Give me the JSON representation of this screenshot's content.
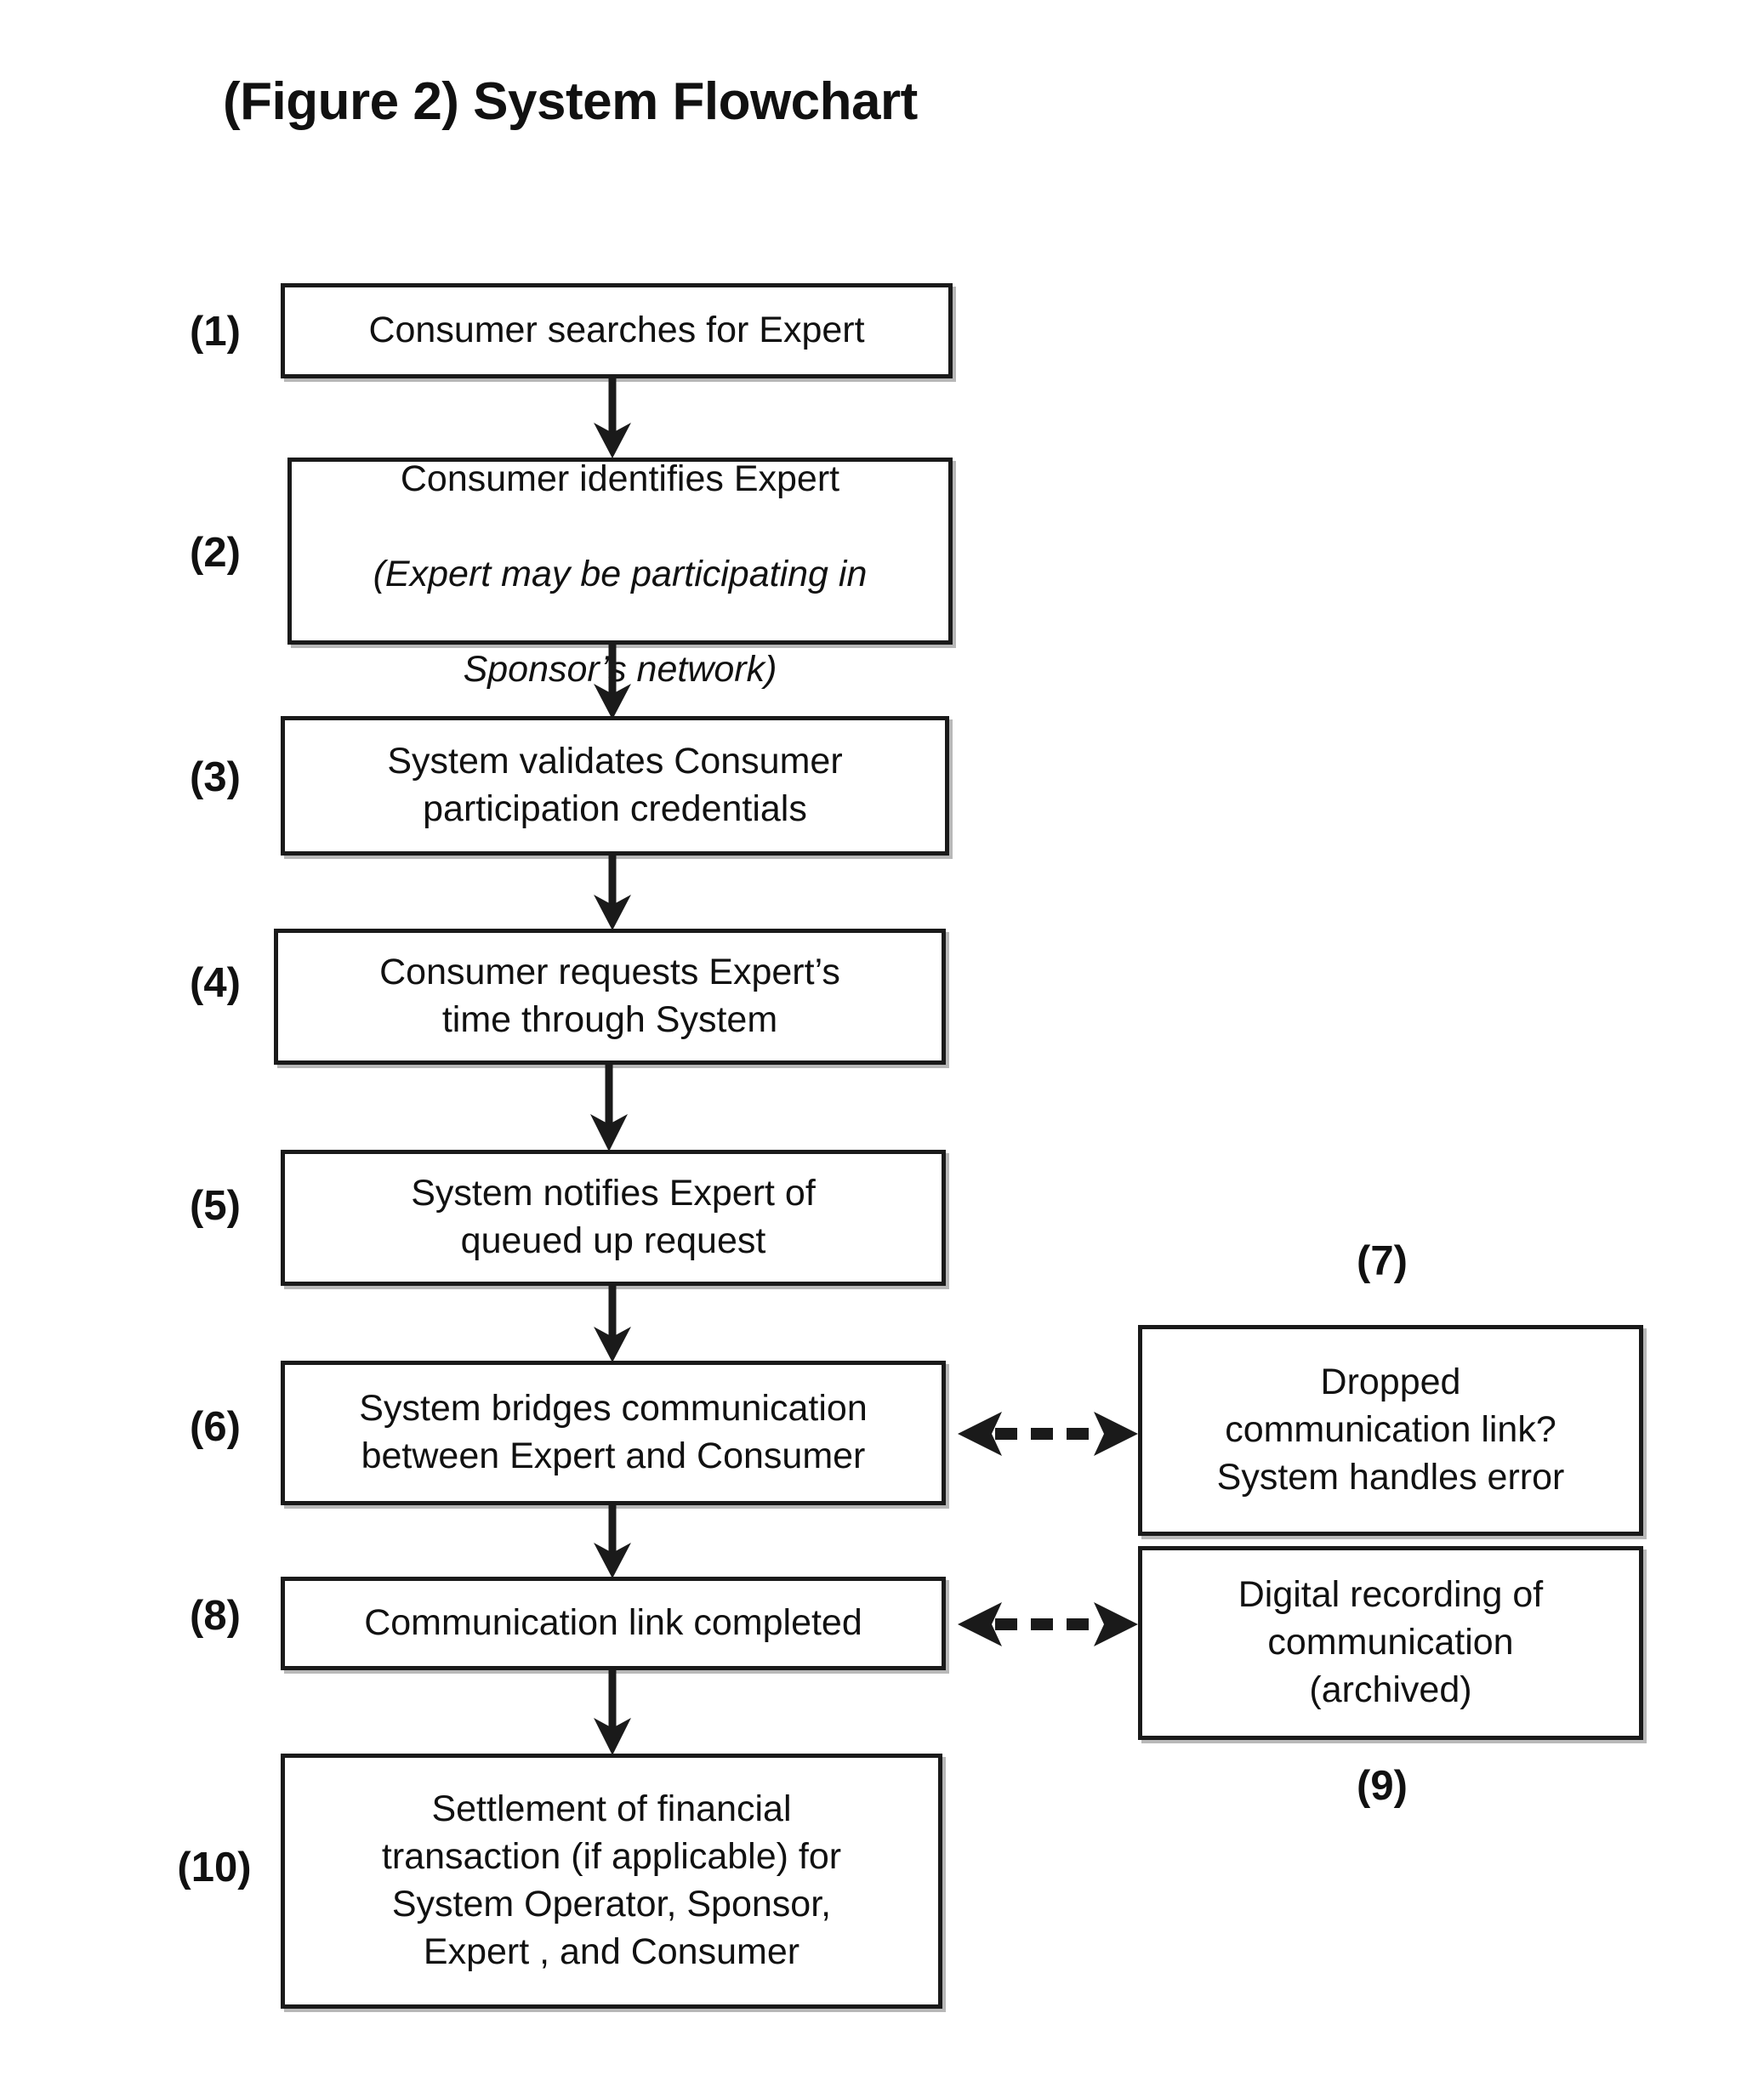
{
  "figure": {
    "title": "(Figure 2) System Flowchart"
  },
  "nodes": [
    {
      "number": "(1)",
      "text": "Consumer searches for Expert",
      "italic_lines": []
    },
    {
      "number": "(2)",
      "text": "Consumer identifies Expert",
      "italic_lines": [
        "(Expert may be participating in",
        "Sponsor’s network)"
      ]
    },
    {
      "number": "(3)",
      "text": "System validates Consumer\nparticipation credentials",
      "italic_lines": []
    },
    {
      "number": "(4)",
      "text": "Consumer requests Expert’s\ntime through System",
      "italic_lines": []
    },
    {
      "number": "(5)",
      "text": "System notifies Expert of\nqueued up request",
      "italic_lines": []
    },
    {
      "number": "(6)",
      "text": "System bridges communication\nbetween Expert and Consumer",
      "italic_lines": []
    },
    {
      "number": "(7)",
      "text": "Dropped\ncommunication link?\nSystem handles error",
      "italic_lines": []
    },
    {
      "number": "(8)",
      "text": "Communication link completed",
      "italic_lines": []
    },
    {
      "number": "(9)",
      "text": "Digital recording of\ncommunication\n(archived)",
      "italic_lines": []
    },
    {
      "number": "(10)",
      "text": "Settlement of financial\ntransaction (if applicable) for\nSystem Operator, Sponsor,\nExpert , and Consumer",
      "italic_lines": []
    }
  ],
  "colors": {
    "stroke": "#1a1a1a",
    "text": "#111111",
    "background": "#ffffff"
  }
}
